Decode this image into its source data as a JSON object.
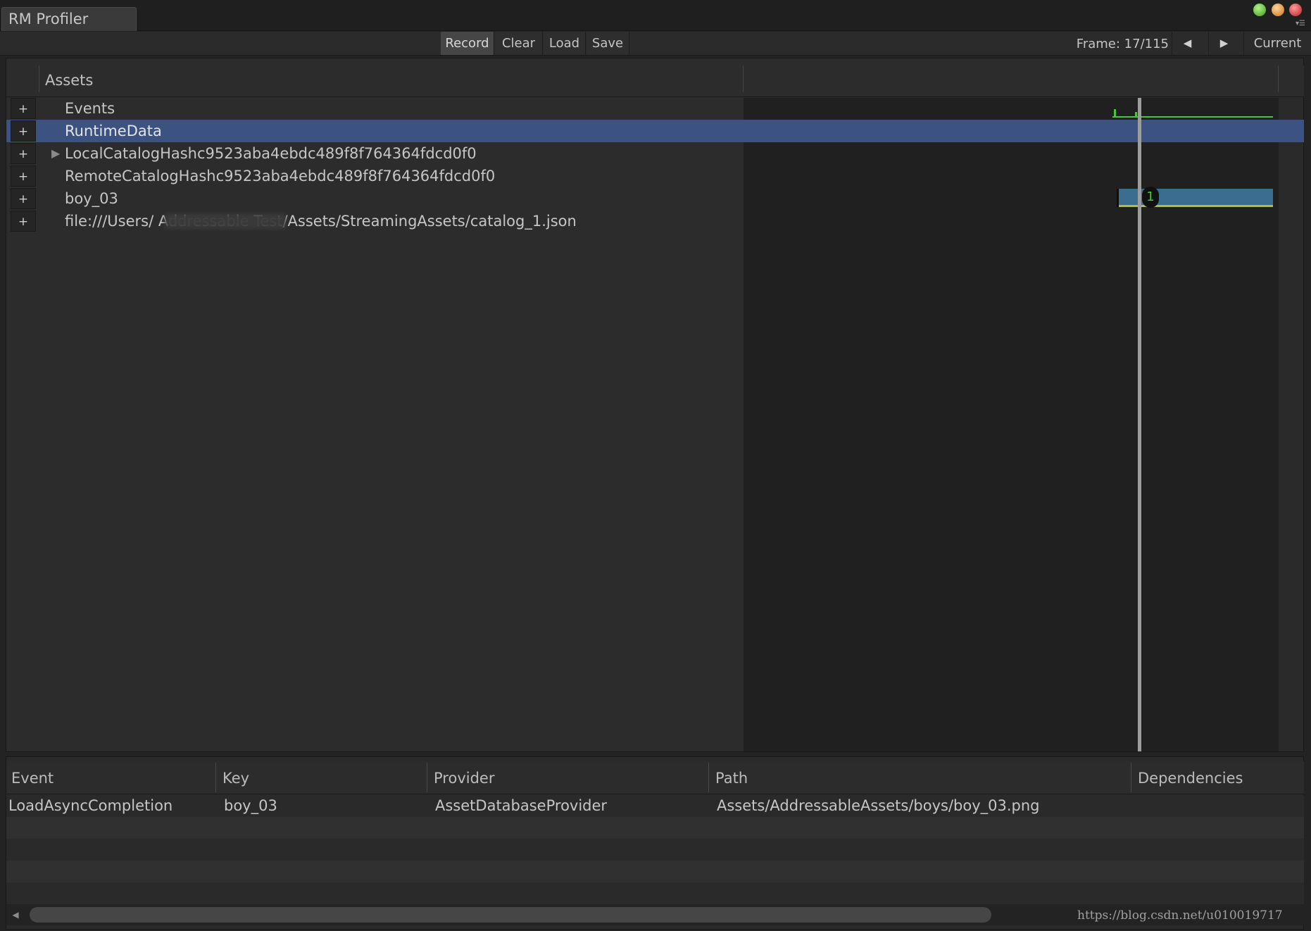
{
  "window": {
    "title": "RM Profiler"
  },
  "toolbar": {
    "record_label": "Record",
    "clear_label": "Clear",
    "load_label": "Load",
    "save_label": "Save",
    "frame_text": "Frame: 17/115",
    "prev_icon": "triangle-left-icon",
    "next_icon": "triangle-right-icon",
    "current_label": "Current"
  },
  "tree": {
    "header": "Assets",
    "rows": [
      {
        "expander": "+",
        "label": "Events",
        "selected": false,
        "has_children": false
      },
      {
        "expander": "+",
        "label": "RuntimeData",
        "selected": true,
        "has_children": false
      },
      {
        "expander": "+",
        "label": "LocalCatalogHashc9523aba4ebdc489f8f764364fdcd0f0",
        "selected": false,
        "has_children": true
      },
      {
        "expander": "+",
        "label": "RemoteCatalogHashc9523aba4ebdc489f8f764364fdcd0f0",
        "selected": false,
        "has_children": false
      },
      {
        "expander": "+",
        "label": "boy_03",
        "selected": false,
        "has_children": false
      },
      {
        "expander": "+",
        "label": "file:///Users/                        Addressable Test/Assets/StreamingAssets/catalog_1.json",
        "selected": false,
        "has_children": false
      }
    ]
  },
  "graph": {
    "ref_count": "1",
    "colors": {
      "event": "#4ec23f",
      "asset_bar": "#3a6d8f",
      "asset_base": "#a8c33a",
      "selection": "#3b5283"
    }
  },
  "events_table": {
    "columns": [
      "Event",
      "Key",
      "Provider",
      "Path",
      "Dependencies"
    ],
    "rows": [
      [
        "LoadAsyncCompletion",
        "boy_03",
        "AssetDatabaseProvider",
        "Assets/AddressableAssets/boys/boy_03.png",
        ""
      ]
    ]
  },
  "watermark": "https://blog.csdn.net/u010019717"
}
